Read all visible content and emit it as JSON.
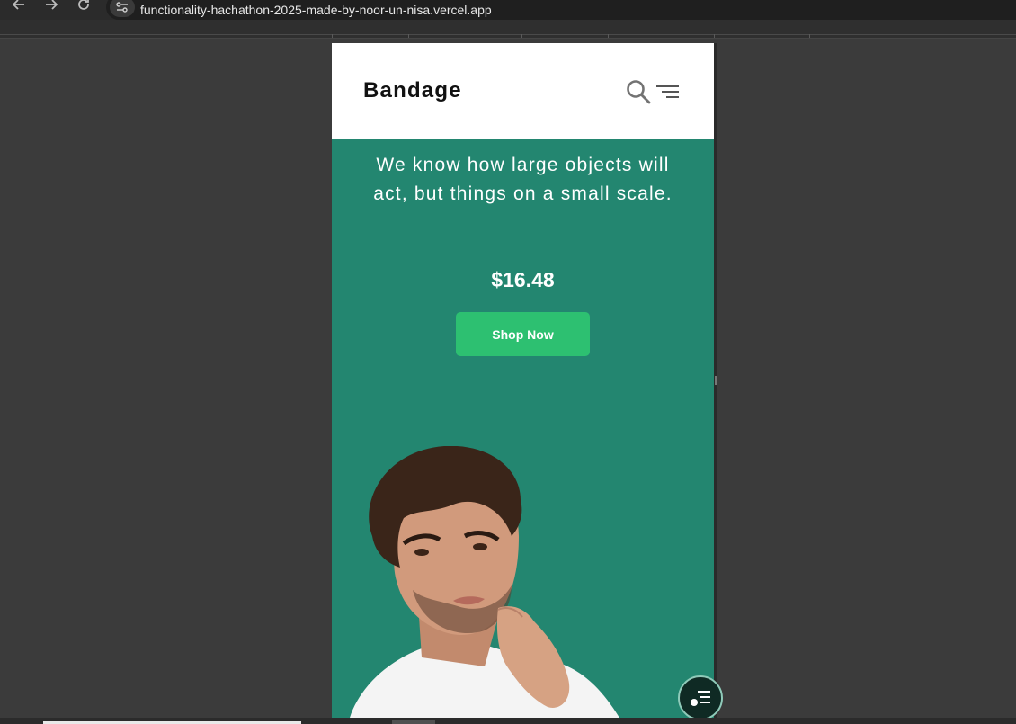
{
  "browser": {
    "url": "functionality-hachathon-2025-made-by-noor-un-nisa.vercel.app",
    "back_icon": "arrow-left",
    "forward_icon": "arrow-right",
    "reload_icon": "reload",
    "site_info_icon": "tune"
  },
  "header": {
    "brand": "Bandage",
    "search_icon": "search",
    "menu_icon": "menu-lines"
  },
  "hero": {
    "tagline": "We know how large objects will act, but things on a small scale.",
    "price": "$16.48",
    "cta_label": "Shop Now",
    "image": "man-in-white-t-shirt-portrait"
  },
  "fab": {
    "icon": "list-sort"
  },
  "colors": {
    "hero_bg": "#238670",
    "cta_bg": "#2dc071",
    "header_bg": "#ffffff"
  }
}
